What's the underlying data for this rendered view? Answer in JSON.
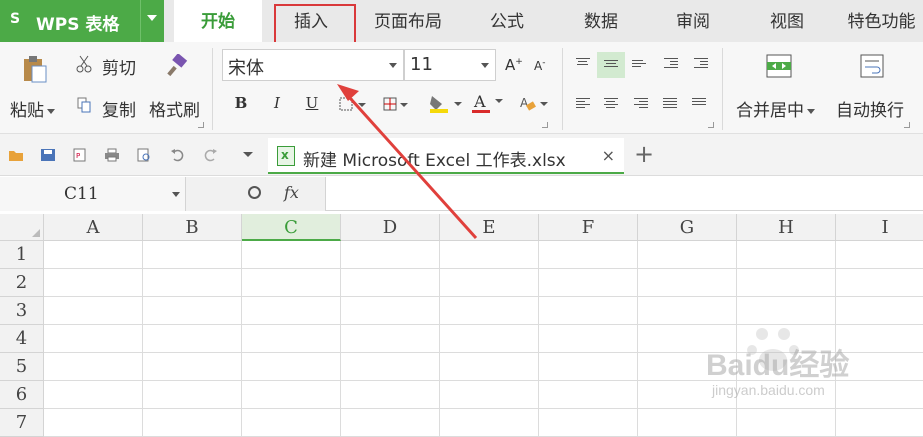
{
  "app": {
    "logo": "S",
    "name": "WPS 表格"
  },
  "tabs": [
    {
      "label": "开始",
      "active": true
    },
    {
      "label": "插入",
      "highlighted": true
    },
    {
      "label": "页面布局"
    },
    {
      "label": "公式"
    },
    {
      "label": "数据"
    },
    {
      "label": "审阅"
    },
    {
      "label": "视图"
    },
    {
      "label": "特色功能"
    }
  ],
  "ribbon": {
    "paste": "粘贴",
    "cut": "剪切",
    "copy": "复制",
    "format_painter": "格式刷",
    "font_name": "宋体",
    "font_size": "11",
    "bold": "B",
    "italic": "I",
    "underline": "U",
    "font_color_letter": "A",
    "merge_center": "合并居中",
    "wrap_text": "自动换行"
  },
  "document_tab": {
    "title": "新建 Microsoft Excel 工作表.xlsx",
    "close": "×"
  },
  "formula_bar": {
    "name_box": "C11",
    "fx": "fx",
    "formula": ""
  },
  "grid": {
    "columns": [
      "A",
      "B",
      "C",
      "D",
      "E",
      "F",
      "G",
      "H",
      "I"
    ],
    "selected_column": "C",
    "rows": [
      "1",
      "2",
      "3",
      "4",
      "5",
      "6",
      "7"
    ]
  },
  "colors": {
    "accent": "#4caa47",
    "highlight_box": "#d9383a",
    "annotation_arrow": "#e0403c"
  },
  "watermark": {
    "brand": "Baidu经验",
    "url": "jingyan.baidu.com"
  }
}
